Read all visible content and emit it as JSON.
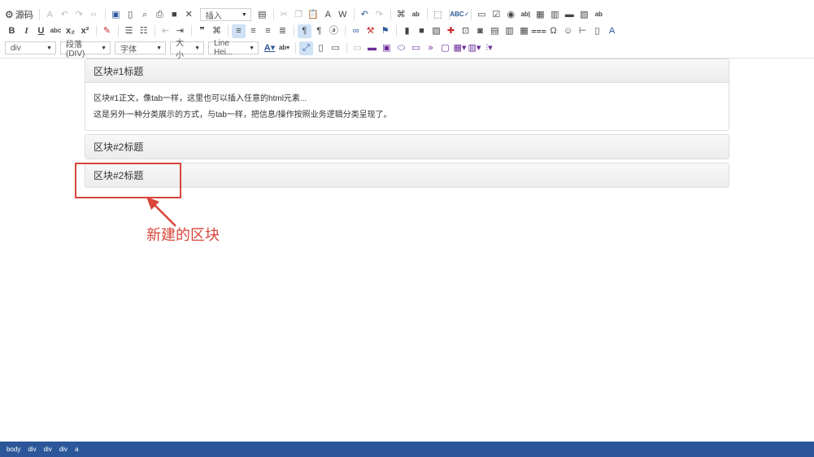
{
  "toolbar": {
    "source_label": "源码",
    "insert_combo": "插入",
    "format_combo": "div",
    "paragraph_combo": "段落(DIV)",
    "font_combo": "字体",
    "size_combo": "大小",
    "lineheight_combo": "Line Hei..."
  },
  "editor": {
    "block1_title": "区块#1标题",
    "block1_line1": "区块#1正文，像tab一样，这里也可以插入任意的html元素...",
    "block1_line2": "这是另外一种分类展示的方式，与tab一样，把信息/操作按照业务逻辑分类呈现了。",
    "block2_title": "区块#2标题",
    "block3_title": "区块#2标题"
  },
  "annotation": {
    "text": "新建的区块",
    "color": "#d9453a"
  },
  "statusbar": {
    "crumbs": [
      "body",
      "div",
      "div",
      "div",
      "a"
    ],
    "color": "#2b579a"
  }
}
